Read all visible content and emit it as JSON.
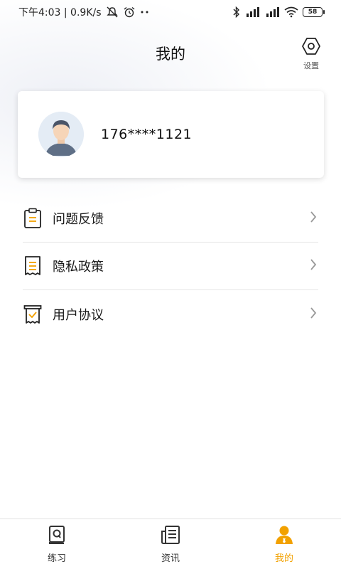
{
  "status_bar": {
    "time_and_speed": "下午4:03 | 0.9K/s",
    "battery": "58"
  },
  "header": {
    "title": "我的",
    "settings_label": "设置"
  },
  "profile": {
    "phone": "176****1121"
  },
  "menu": [
    {
      "label": "问题反馈",
      "icon": "feedback-clipboard-icon"
    },
    {
      "label": "隐私政策",
      "icon": "privacy-receipt-icon"
    },
    {
      "label": "用户协议",
      "icon": "agreement-check-icon"
    }
  ],
  "bottom_nav": [
    {
      "label": "练习",
      "icon": "practice-book-icon"
    },
    {
      "label": "资讯",
      "icon": "news-document-icon"
    },
    {
      "label": "我的",
      "icon": "profile-person-icon",
      "active": true
    }
  ],
  "colors": {
    "accent": "#f2a100",
    "divider": "#e6e6e6",
    "text_primary": "#1a1a1a"
  }
}
